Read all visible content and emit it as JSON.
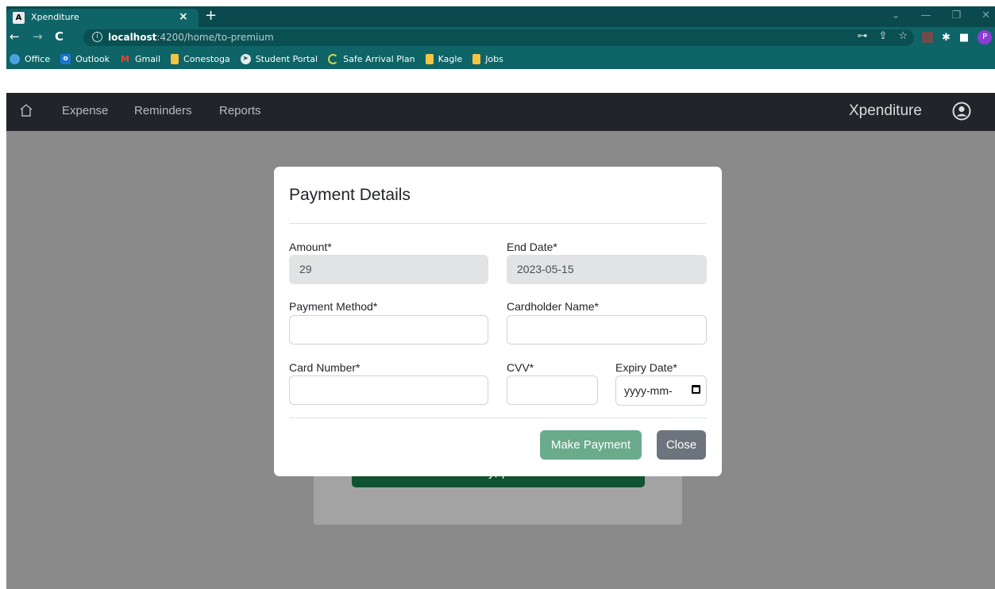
{
  "browser": {
    "tab_title": "Xpenditure",
    "tab_favicon": "A",
    "url_host": "localhost",
    "url_path": ":4200/home/to-premium",
    "profile_initial": "P",
    "bookmarks": [
      {
        "label": "Office",
        "icon": "office-icon",
        "color": "#4aa3df"
      },
      {
        "label": "Outlook",
        "icon": "outlook-icon",
        "color": "#1976d2"
      },
      {
        "label": "Gmail",
        "icon": "gmail-icon",
        "color": "#ea4335"
      },
      {
        "label": "Conestoga",
        "icon": "folder-icon",
        "color": "#f4c542"
      },
      {
        "label": "Student Portal",
        "icon": "portal-icon",
        "color": "#e8eaed"
      },
      {
        "label": "Safe Arrival Plan",
        "icon": "loading-icon",
        "color": "#c9d84a"
      },
      {
        "label": "Kagle",
        "icon": "folder-icon",
        "color": "#f4c542"
      },
      {
        "label": "Jobs",
        "icon": "folder-icon",
        "color": "#f4c542"
      }
    ]
  },
  "navbar": {
    "links": [
      "Expense",
      "Reminders",
      "Reports"
    ],
    "brand": "Xpenditure"
  },
  "background": {
    "button_partial_text": "y,                      p"
  },
  "modal": {
    "title": "Payment Details",
    "amount_label": "Amount*",
    "amount_value": "29",
    "end_date_label": "End Date*",
    "end_date_value": "2023-05-15",
    "payment_method_label": "Payment Method*",
    "payment_method_value": "",
    "cardholder_label": "Cardholder Name*",
    "cardholder_value": "",
    "card_number_label": "Card Number*",
    "card_number_value": "",
    "cvv_label": "CVV*",
    "cvv_value": "",
    "expiry_label": "Expiry Date*",
    "expiry_placeholder": "yyyy-mm-",
    "make_payment_label": "Make Payment",
    "close_label": "Close"
  },
  "colors": {
    "chrome_dark": "#0a4a4e",
    "chrome": "#0e6466",
    "navbar": "#212529",
    "primary_success": "#6aab8c",
    "secondary": "#6c757d"
  }
}
